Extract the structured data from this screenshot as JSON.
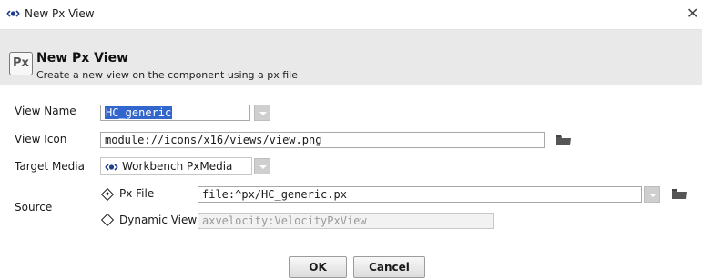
{
  "window": {
    "title": "New Px View",
    "close_symbol": "✕"
  },
  "header": {
    "icon_text": "Px",
    "title": "New Px View",
    "subtitle": "Create a new view on the component using a px file"
  },
  "form": {
    "view_name": {
      "label": "View Name",
      "value": "HC_generic"
    },
    "view_icon": {
      "label": "View Icon",
      "value": "module://icons/x16/views/view.png"
    },
    "target_media": {
      "label": "Target Media",
      "value": "Workbench PxMedia"
    },
    "source": {
      "label": "Source",
      "px_file": {
        "label": "Px File",
        "value": "file:^px/HC_generic.px",
        "selected": true
      },
      "dynamic_view": {
        "label": "Dynamic View",
        "value": "axvelocity:VelocityPxView",
        "selected": false
      }
    }
  },
  "buttons": {
    "ok": "OK",
    "cancel": "Cancel"
  },
  "colors": {
    "selection": "#3366cc",
    "media_icon": "#1e3c8c",
    "folder": "#555555"
  },
  "icons": {
    "title": "px-media-eye-icon",
    "folder": "folder-icon"
  }
}
